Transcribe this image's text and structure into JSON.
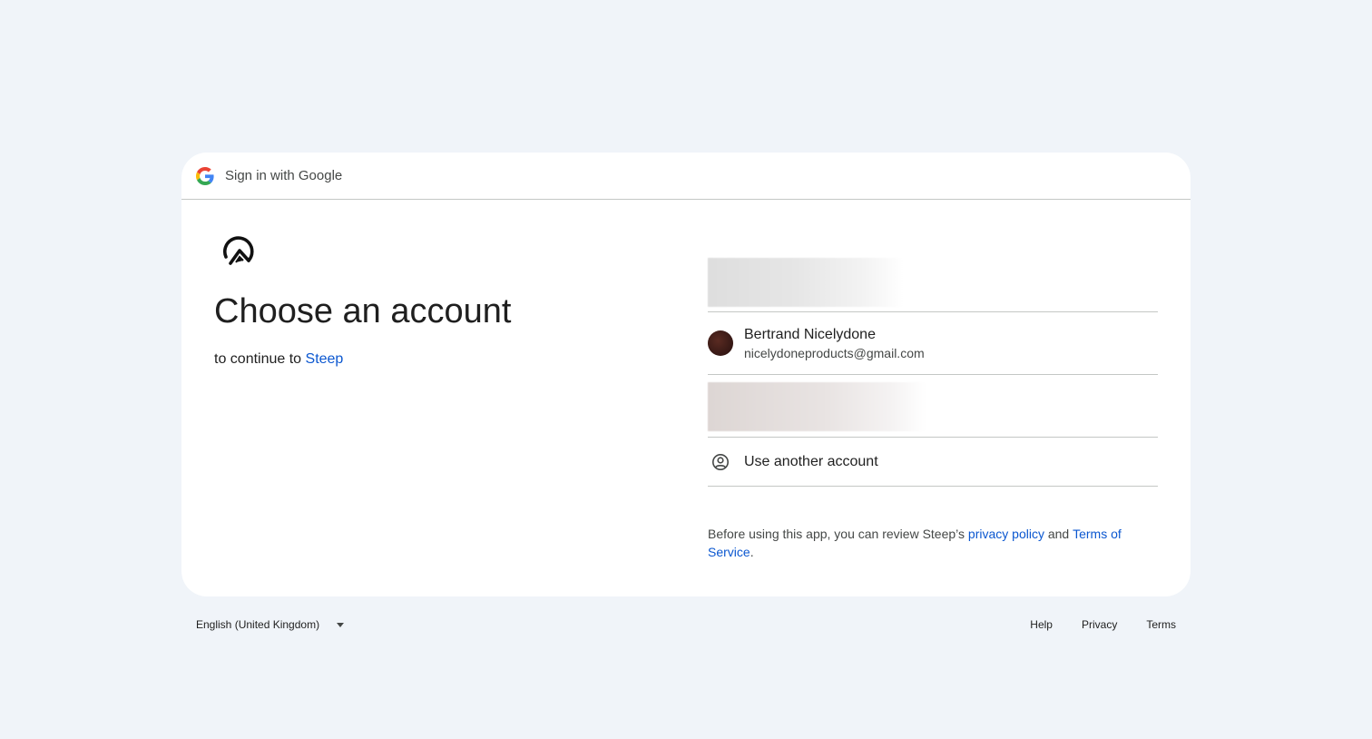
{
  "header": {
    "title": "Sign in with Google",
    "logo_icon": "google-g-icon"
  },
  "main": {
    "app_icon": "steep-app-logo-icon",
    "title": "Choose an account",
    "subtitle_prefix": "to continue to ",
    "app_name": "Steep"
  },
  "accounts": [
    {
      "name": "Bertrand Nicelydone",
      "email": "nicelydoneproducts@gmail.com",
      "avatar_color": "#3a1a16"
    }
  ],
  "use_another": {
    "label": "Use another account",
    "icon": "account-circle-icon"
  },
  "disclaimer": {
    "prefix": "Before using this app, you can review Steep’s ",
    "privacy_link": "privacy policy",
    "and": " and ",
    "terms_link": "Terms of Service",
    "suffix": "."
  },
  "footer": {
    "language": "English (United Kingdom)",
    "links": [
      "Help",
      "Privacy",
      "Terms"
    ]
  },
  "colors": {
    "page_bg": "#f0f4f9",
    "card_bg": "#ffffff",
    "link": "#0b57d0",
    "divider": "#c4c7c5"
  }
}
